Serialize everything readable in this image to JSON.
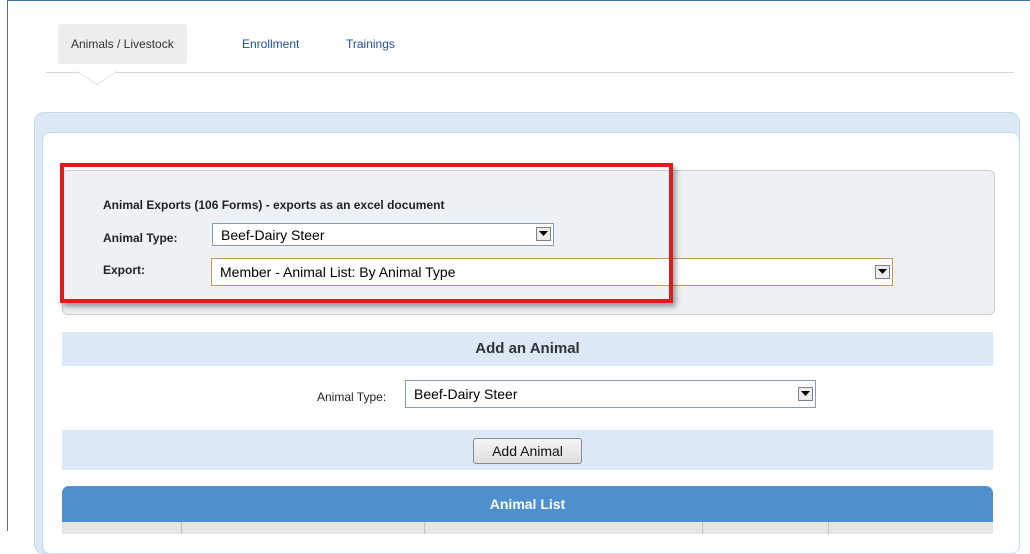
{
  "tabs": [
    {
      "label": "Animals / Livestock",
      "active": true
    },
    {
      "label": "Enrollment",
      "active": false
    },
    {
      "label": "Trainings",
      "active": false
    }
  ],
  "exports": {
    "title": "Animal Exports (106 Forms) - exports as an excel document",
    "animal_type_label": "Animal Type:",
    "animal_type_value": "Beef-Dairy Steer",
    "export_label": "Export:",
    "export_value": "Member - Animal List: By Animal Type"
  },
  "add_animal": {
    "heading": "Add an Animal",
    "animal_type_label": "Animal Type:",
    "animal_type_value": "Beef-Dairy Steer",
    "button_label": "Add Animal"
  },
  "animal_list": {
    "heading": "Animal List"
  },
  "colors": {
    "highlight": "#e31a1a",
    "list_header": "#4d90cd",
    "panel_bg": "#dbe8f5",
    "link": "#1f4e9c"
  },
  "icons": [
    "dropdown-arrow-icon"
  ]
}
